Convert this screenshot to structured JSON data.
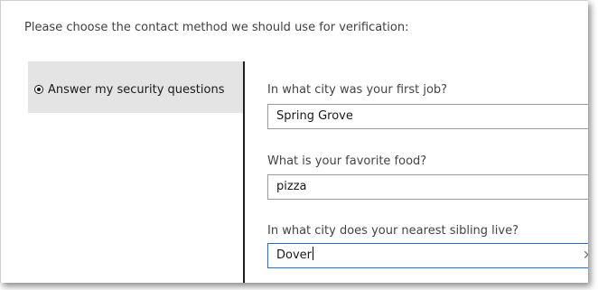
{
  "prompt": "Please choose the contact method we should use for verification:",
  "methods": [
    {
      "label": "Answer my security questions",
      "selected": true
    }
  ],
  "questions": [
    {
      "label": "In what city was your first job?",
      "answer": "Spring Grove"
    },
    {
      "label": "What is your favorite food?",
      "answer": "pizza"
    },
    {
      "label": "In what city does your nearest sibling live?",
      "answer": "Dover"
    }
  ],
  "icons": {
    "clear": "close-icon"
  },
  "colors": {
    "focus_border": "#1e6fd9",
    "selected_bg": "#e4e4e4"
  }
}
